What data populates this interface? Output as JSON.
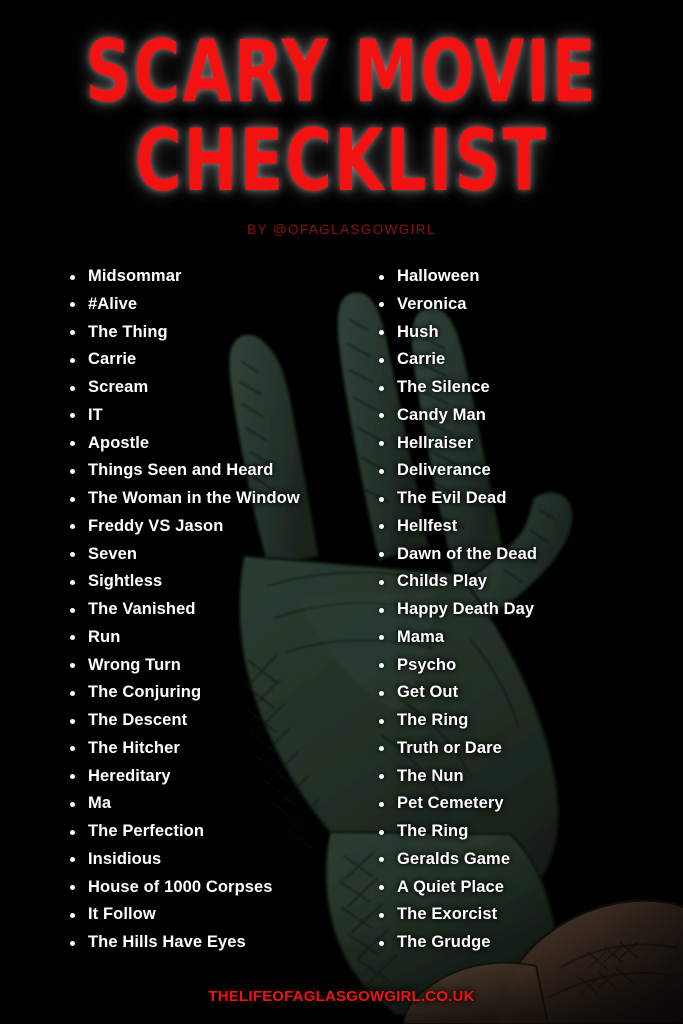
{
  "poster": {
    "title_line_1": "SCARY MOVIE",
    "title_line_2": "CHECKLIST",
    "byline": "BY @OFAGLASGOWGIRL",
    "footer": "THELIFEOFAGLASGOWGIRL.CO.UK",
    "colors": {
      "background": "#000000",
      "title_red": "#f21212",
      "byline_red": "#8d1212",
      "footer_red": "#f21212",
      "list_text": "#ffffff",
      "hand_green": "#223027",
      "hand_green_light": "#2d3c32",
      "hand_outline": "#11180f",
      "dirt_brown": "#5a4334"
    }
  },
  "list": {
    "left_column": [
      "Midsommar",
      "#Alive",
      "The Thing",
      "Carrie",
      "Scream",
      "IT",
      "Apostle",
      "Things Seen and Heard",
      "The Woman in the Window",
      "Freddy VS Jason",
      "Seven",
      "Sightless",
      "The Vanished",
      "Run",
      "Wrong Turn",
      "The Conjuring",
      "The Descent",
      "The Hitcher",
      "Hereditary",
      "Ma",
      "The Perfection",
      "Insidious",
      "House of 1000 Corpses",
      "It Follow",
      "The Hills Have Eyes"
    ],
    "right_column": [
      "Halloween",
      "Veronica",
      "Hush",
      "Carrie",
      "The Silence",
      "Candy Man",
      "Hellraiser",
      "Deliverance",
      "The Evil Dead",
      "Hellfest",
      "Dawn of the Dead",
      "Childs Play",
      "Happy Death Day",
      "Mama",
      "Psycho",
      "Get Out",
      "The Ring",
      "Truth or Dare",
      "The Nun",
      "Pet Cemetery",
      "The Ring",
      "Geralds Game",
      "A Quiet Place",
      "The Exorcist",
      "The Grudge"
    ]
  }
}
